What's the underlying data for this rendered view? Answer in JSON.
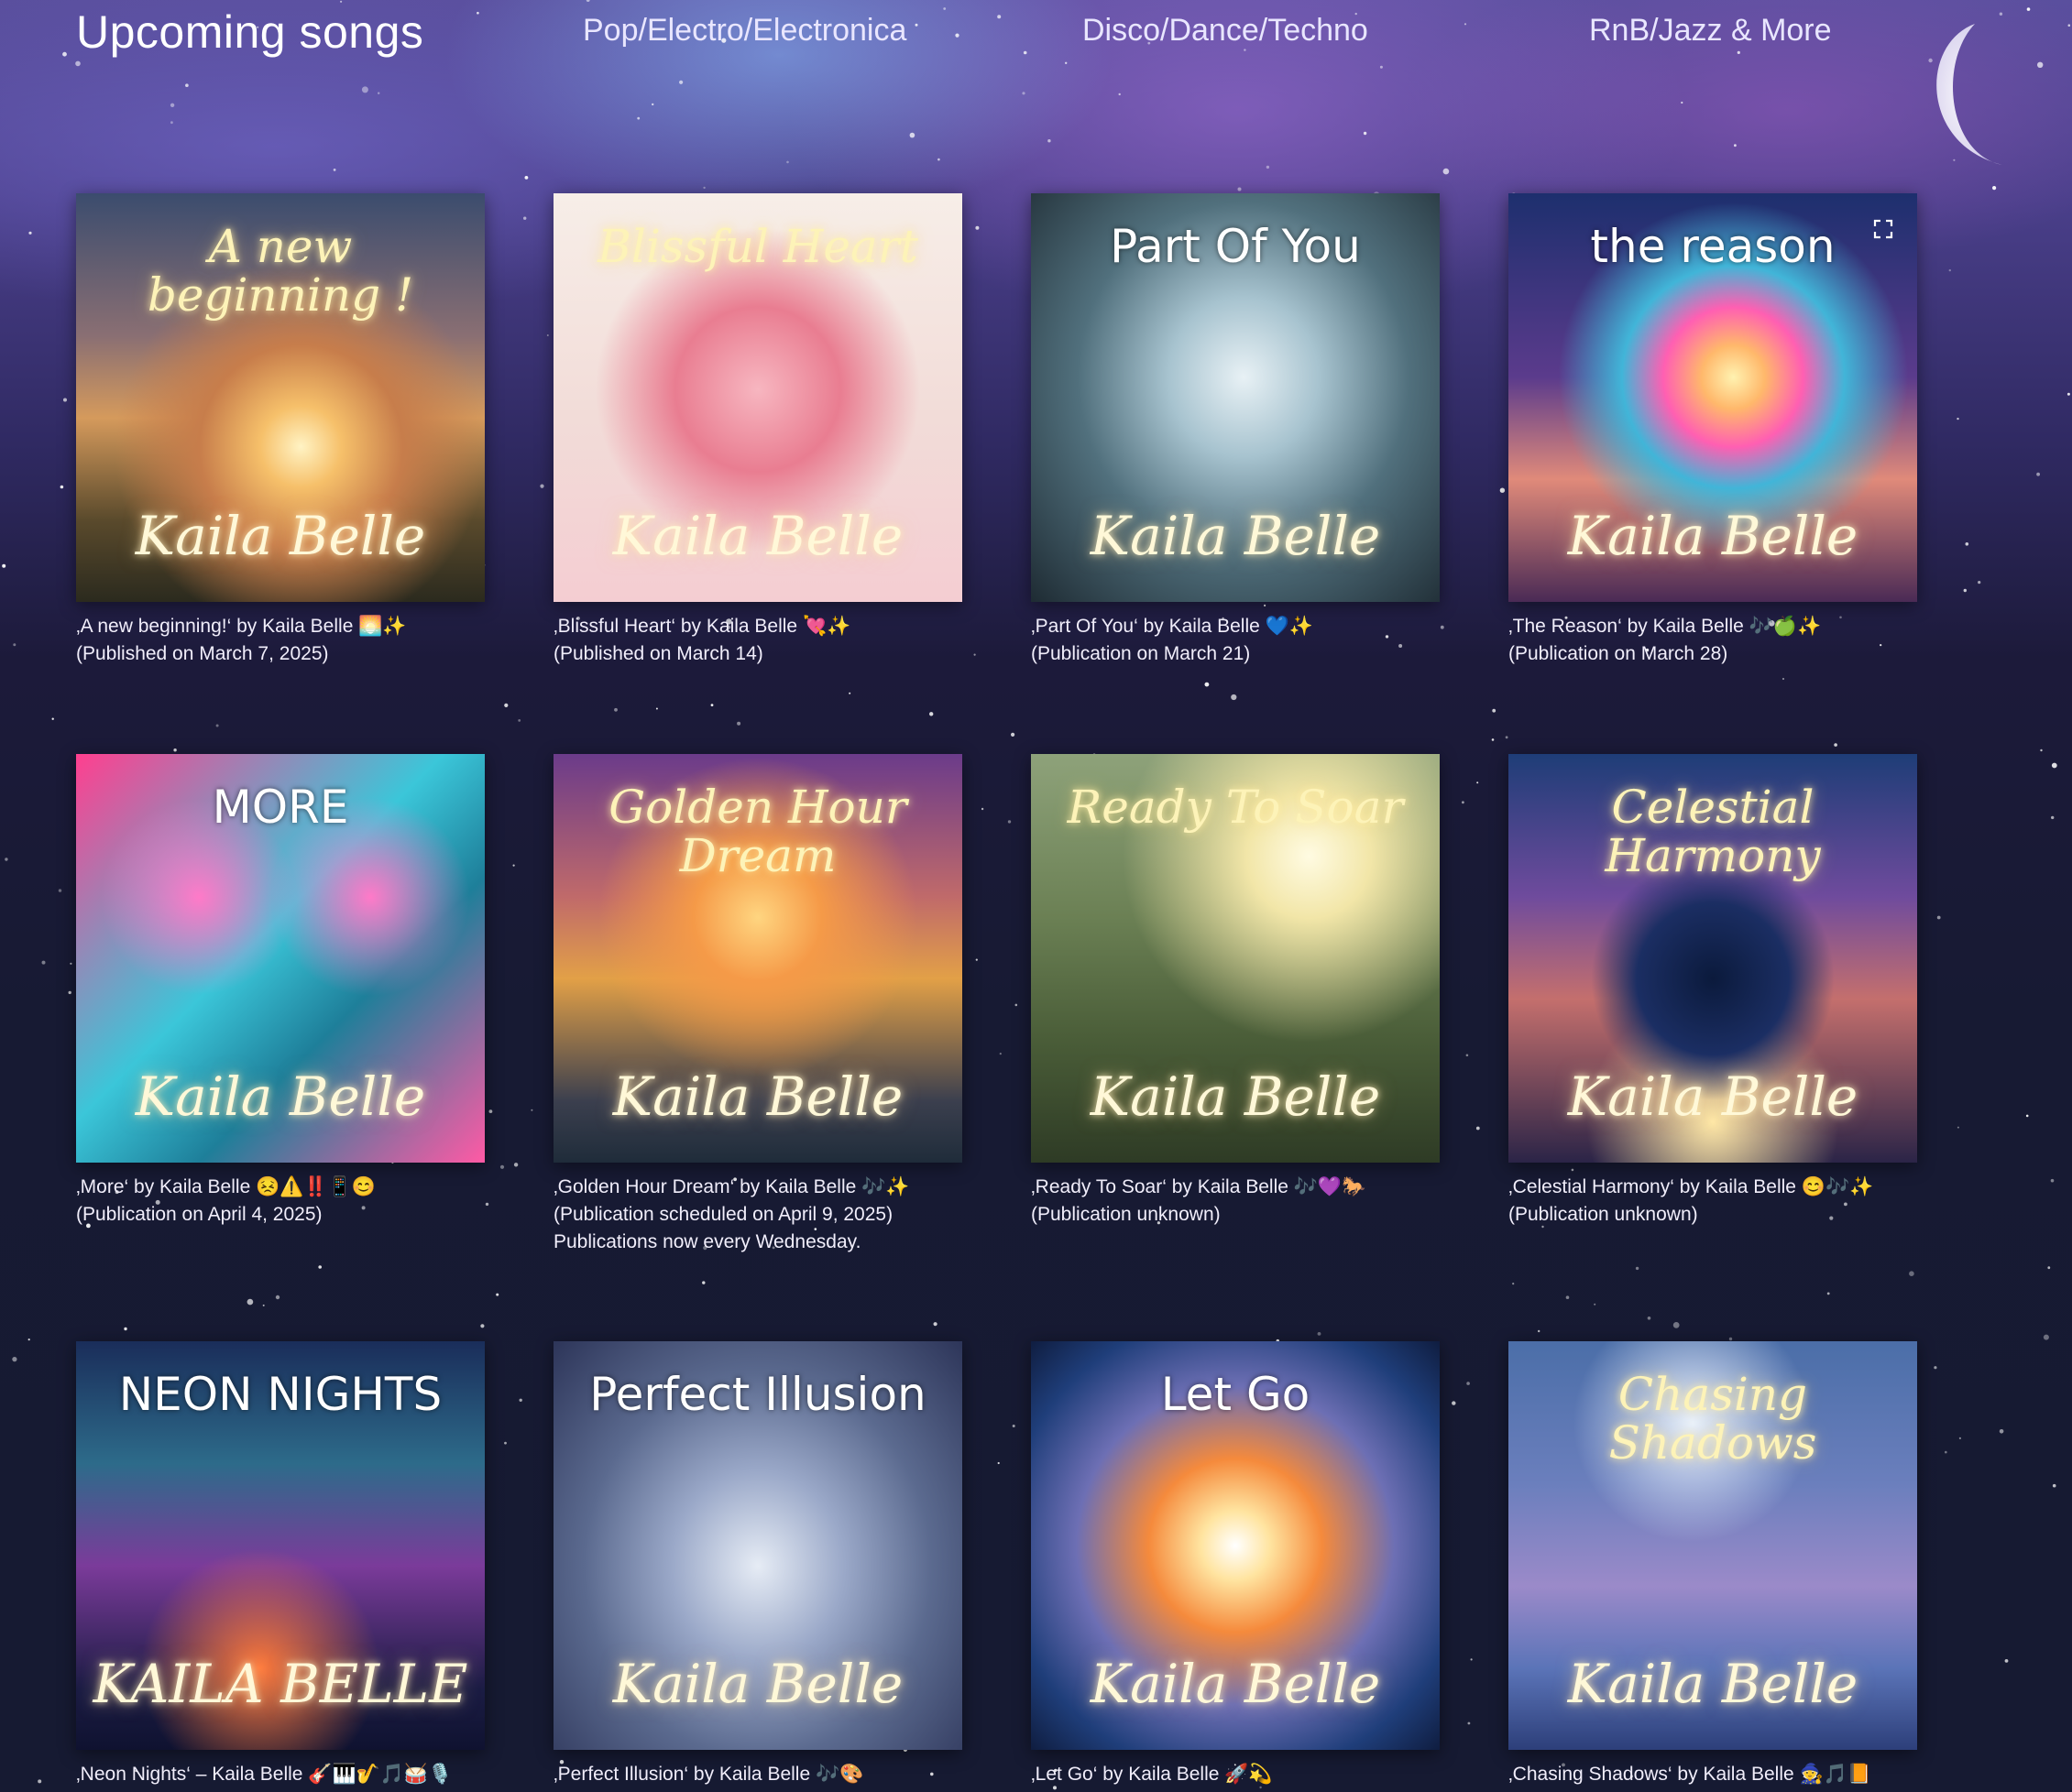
{
  "header": {
    "title": "Upcoming songs",
    "nav": [
      "Pop/Electro/Electronica",
      "Disco/Dance/Techno",
      "RnB/Jazz & More"
    ]
  },
  "colors": {
    "sky_top": "#5a4f9e",
    "sky_bottom": "#161a32",
    "caption_text": "#f1eefb",
    "neon_gold": "#fdf3b8"
  },
  "songs": [
    {
      "cover_title": "A new beginning !",
      "cover_artist": "Kaila Belle",
      "caption_title": "‚A new beginning!‘ by Kaila Belle 🌅✨",
      "caption_date": "(Published on March 7, 2025)",
      "caption_note": ""
    },
    {
      "cover_title": "Blissful Heart",
      "cover_artist": "Kaila Belle",
      "caption_title": "‚Blissful Heart‘ by Kaila Belle 💘✨",
      "caption_date": "(Published on March 14)",
      "caption_note": ""
    },
    {
      "cover_title": "Part Of You",
      "cover_artist": "Kaila Belle",
      "caption_title": "‚Part Of You‘ by Kaila Belle 💙✨",
      "caption_date": "(Publication on March 21)",
      "caption_note": ""
    },
    {
      "cover_title": "the reason",
      "cover_artist": "Kaila Belle",
      "caption_title": "‚The Reason‘ by Kaila Belle 🎶🍏✨",
      "caption_date": "(Publication on March 28)",
      "caption_note": ""
    },
    {
      "cover_title": "MORE",
      "cover_artist": "Kaila Belle",
      "caption_title": "‚More‘ by Kaila Belle 😣⚠️‼️📱😊",
      "caption_date": "(Publication on April 4, 2025)",
      "caption_note": ""
    },
    {
      "cover_title": "Golden Hour Dream",
      "cover_artist": "Kaila Belle",
      "caption_title": "‚Golden Hour Dream‘ by Kaila Belle 🎶✨",
      "caption_date": "(Publication scheduled on April 9, 2025)",
      "caption_note": "Publications now every Wednesday."
    },
    {
      "cover_title": "Ready To Soar",
      "cover_artist": "Kaila Belle",
      "caption_title": "‚Ready To Soar‘ by Kaila Belle 🎶💜🐎",
      "caption_date": "(Publication unknown)",
      "caption_note": ""
    },
    {
      "cover_title": "Celestial Harmony",
      "cover_artist": "Kaila Belle",
      "caption_title": "‚Celestial Harmony‘ by Kaila Belle 😊🎶✨",
      "caption_date": "(Publication unknown)",
      "caption_note": ""
    },
    {
      "cover_title": "NEON NIGHTS",
      "cover_artist": "KAILA BELLE",
      "caption_title": "‚Neon Nights‘ – Kaila Belle 🎸🎹🎷🎵🥁🎙️",
      "caption_date": "",
      "caption_note": ""
    },
    {
      "cover_title": "Perfect Illusion",
      "cover_artist": "Kaila Belle",
      "caption_title": "‚Perfect Illusion‘ by Kaila Belle 🎶🎨",
      "caption_date": "",
      "caption_note": ""
    },
    {
      "cover_title": "Let Go",
      "cover_artist": "Kaila Belle",
      "caption_title": "‚Let Go‘ by Kaila Belle 🚀💫",
      "caption_date": "",
      "caption_note": ""
    },
    {
      "cover_title": "Chasing Shadows",
      "cover_artist": "Kaila Belle",
      "caption_title": "‚Chasing Shadows‘ by Kaila Belle 🧙🎵📙",
      "caption_date": "",
      "caption_note": ""
    }
  ]
}
